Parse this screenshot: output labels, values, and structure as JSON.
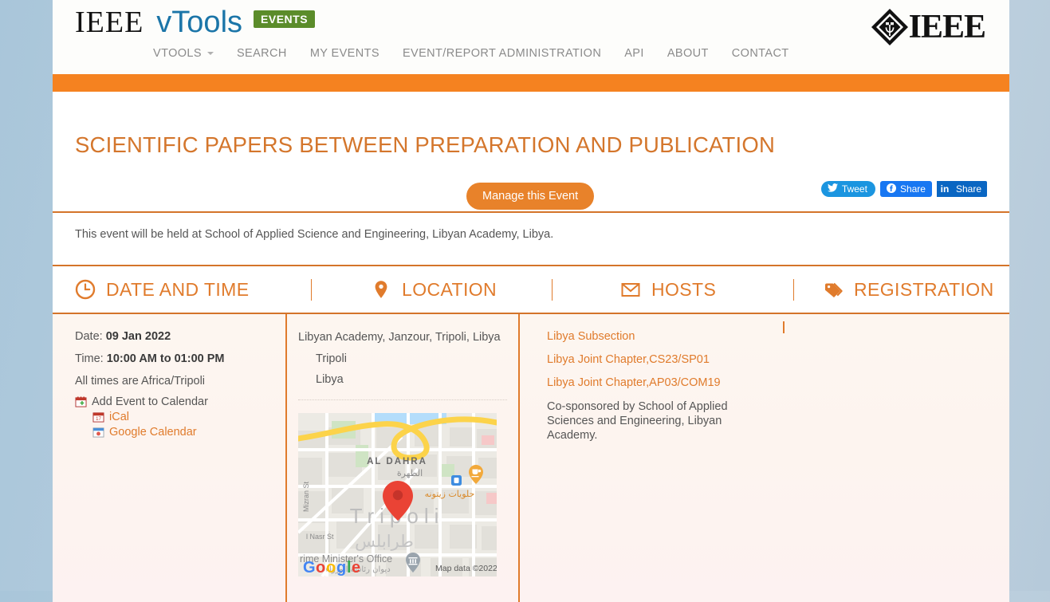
{
  "brand": {
    "ieee": "IEEE",
    "vtools": "vTools",
    "badge": "EVENTS",
    "mark_word": "IEEE"
  },
  "nav": {
    "items": [
      {
        "label": "VTOOLS",
        "caret": true
      },
      {
        "label": "SEARCH",
        "caret": false
      },
      {
        "label": "MY EVENTS",
        "caret": false
      },
      {
        "label": "EVENT/REPORT ADMINISTRATION",
        "caret": false
      },
      {
        "label": "API",
        "caret": false
      },
      {
        "label": "ABOUT",
        "caret": false
      },
      {
        "label": "CONTACT",
        "caret": false
      }
    ]
  },
  "event": {
    "title": "SCIENTIFIC PAPERS BETWEEN PREPARATION AND PUBLICATION",
    "manage_label": "Manage this Event",
    "description": "This event will be held at School of Applied Science and Engineering, Libyan Academy, Libya."
  },
  "share": {
    "tweet": "Tweet",
    "facebook": "Share",
    "linkedin_mark": "in",
    "linkedin": "Share"
  },
  "tabs": [
    {
      "label": "DATE AND TIME",
      "icon": "clock-icon"
    },
    {
      "label": "LOCATION",
      "icon": "map-pin-icon"
    },
    {
      "label": "HOSTS",
      "icon": "envelope-icon"
    },
    {
      "label": "REGISTRATION",
      "icon": "tag-icon"
    }
  ],
  "datetime": {
    "date_label": "Date:",
    "date_value": "09 Jan 2022",
    "time_label": "Time:",
    "time_value": "10:00 AM to 01:00 PM",
    "timezone_note": "All times are Africa/Tripoli",
    "add_calendar": "Add Event to Calendar",
    "ical": "iCal",
    "google_calendar": "Google Calendar"
  },
  "location": {
    "address": "Libyan Academy, Janzour, Tripoli, Libya",
    "city": "Tripoli",
    "country": "Libya",
    "map": {
      "label_area_en": "AL DAHRA",
      "label_area_ar": "الظهرة",
      "label_city_en": "Tripoli",
      "label_city_ar": "طرابلس",
      "label_street_1": "Mizran St",
      "label_street_2": "Al Nasr St",
      "poi_office": "rime Minister's Office",
      "poi_office_ar": "ديوان رئاسة الوزراء",
      "poi_sweets_ar": "حلويات زيتونه",
      "attribution": "Map data ©2022",
      "logo": "Google"
    }
  },
  "hosts": {
    "links": [
      "Libya Subsection",
      "Libya Joint Chapter,CS23/SP01",
      "Libya Joint Chapter,AP03/COM19"
    ],
    "note": "Co-sponsored by School of Applied Sciences and Engineering, Libyan Academy."
  },
  "colors": {
    "orange": "#f58220",
    "title_orange": "#d4762c",
    "link_orange": "#e07b2c",
    "vtools_blue": "#1b75a8",
    "badge_green": "#5b8c2a",
    "twitter": "#1b95e0",
    "facebook": "#1877f2",
    "linkedin": "#0a66c2"
  }
}
